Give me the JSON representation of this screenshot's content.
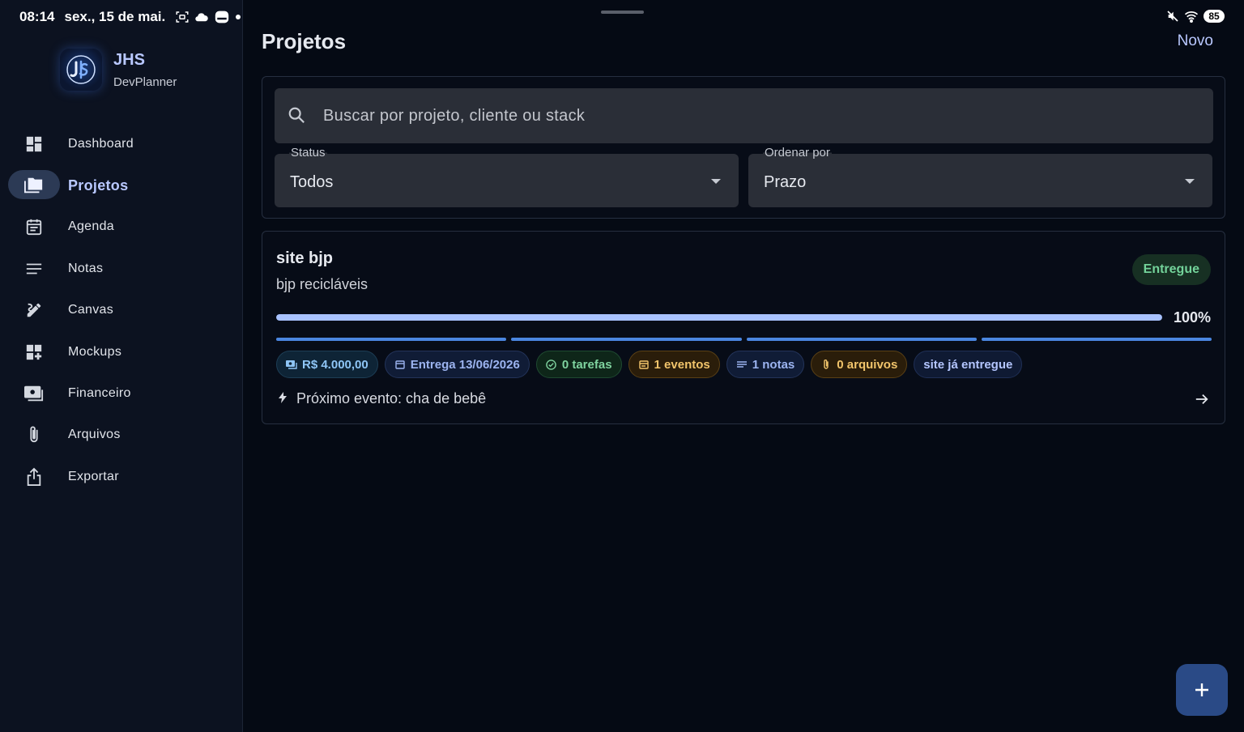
{
  "status_bar": {
    "time": "08:14",
    "date": "sex., 15 de mai.",
    "battery": "85"
  },
  "brand": {
    "name": "JHS",
    "subtitle": "DevPlanner"
  },
  "sidebar": {
    "items": [
      {
        "label": "Dashboard",
        "icon": "dashboard-icon"
      },
      {
        "label": "Projetos",
        "icon": "folders-icon",
        "active": true
      },
      {
        "label": "Agenda",
        "icon": "calendar-icon"
      },
      {
        "label": "Notas",
        "icon": "notes-icon"
      },
      {
        "label": "Canvas",
        "icon": "draw-icon"
      },
      {
        "label": "Mockups",
        "icon": "widgets-icon"
      },
      {
        "label": "Financeiro",
        "icon": "money-icon"
      },
      {
        "label": "Arquivos",
        "icon": "attachment-icon"
      },
      {
        "label": "Exportar",
        "icon": "share-icon"
      }
    ]
  },
  "header": {
    "title": "Projetos",
    "new_label": "Novo"
  },
  "filters": {
    "search_placeholder": "Buscar por projeto, cliente ou stack",
    "status_label": "Status",
    "status_value": "Todos",
    "order_label": "Ordenar por",
    "order_value": "Prazo"
  },
  "project": {
    "title": "site bjp",
    "client": "bjp recicláveis",
    "status": "Entregue",
    "progress": 1.0,
    "progress_label": "100%",
    "chips": {
      "value": "R$ 4.000,00",
      "delivery": "Entrega 13/06/2026",
      "tasks": "0 tarefas",
      "events": "1 eventos",
      "notes": "1 notas",
      "files": "0 arquivos",
      "tag": "site já entregue"
    },
    "next_event": "Próximo evento: cha de bebê"
  },
  "colors": {
    "accent": "#b9c8ff",
    "success": "#73d39a",
    "warning": "#f1c46b",
    "background": "#050a14"
  }
}
